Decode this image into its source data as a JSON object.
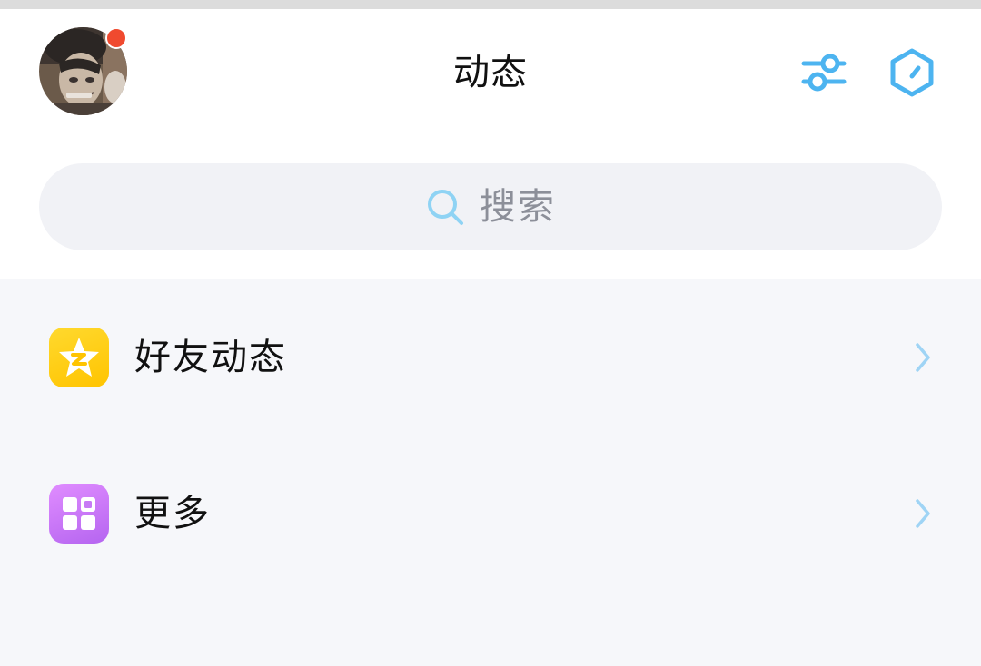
{
  "header": {
    "title": "动态",
    "avatar_icon": "user-avatar",
    "has_notification": true,
    "settings_icon": "sliders-icon",
    "hexagon_icon": "hexagon-clock-icon"
  },
  "search": {
    "placeholder": "搜索",
    "icon": "search-icon"
  },
  "list": {
    "items": [
      {
        "label": "好友动态",
        "icon": "qzone-star-icon"
      },
      {
        "label": "更多",
        "icon": "grid-apps-icon"
      }
    ]
  },
  "colors": {
    "accent": "#4db4f0",
    "notification": "#f04a2f",
    "qzone_yellow": "#ffc400",
    "more_purple": "#c77af5",
    "chevron": "#9fd4f5",
    "search_icon": "#8fd3f4"
  }
}
